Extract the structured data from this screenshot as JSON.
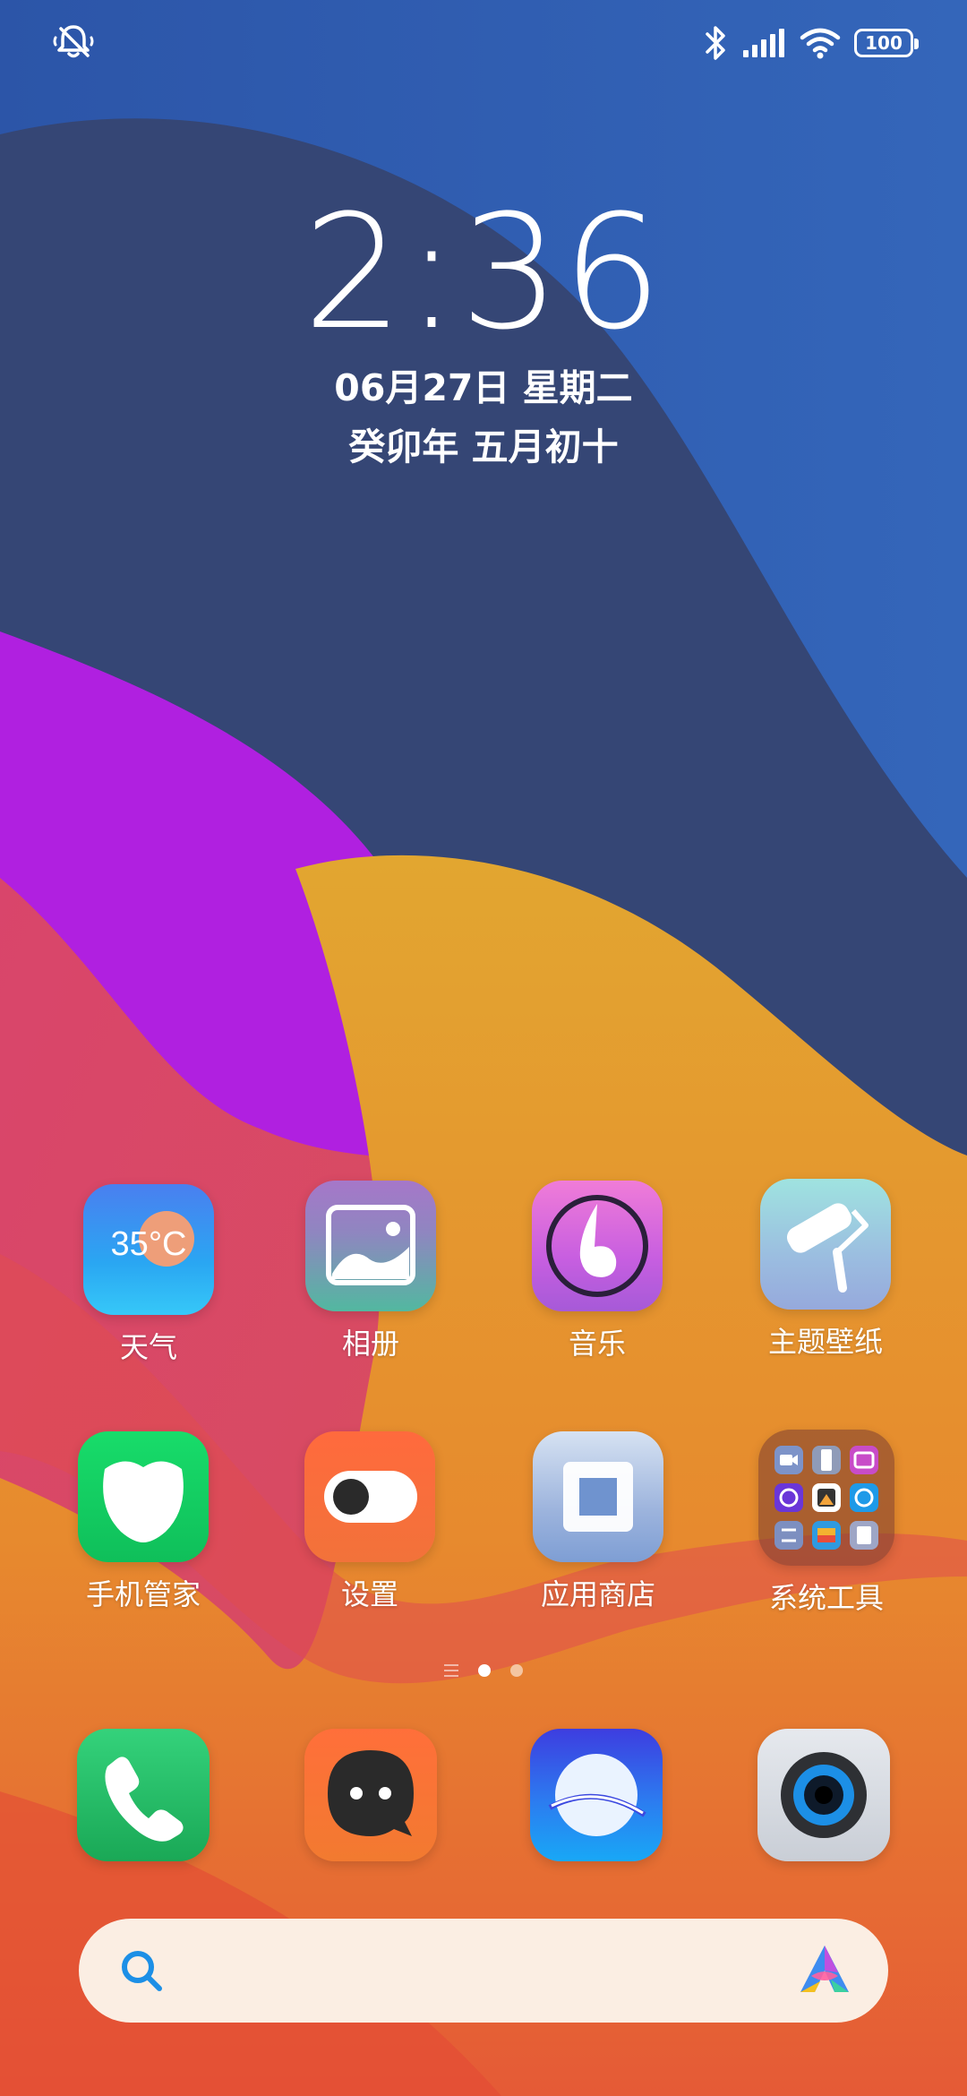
{
  "status_bar": {
    "left_icon": "mute-notification-icon",
    "right_icons": [
      "bluetooth-icon",
      "signal-icon",
      "wifi-icon"
    ],
    "battery": "100"
  },
  "clock": {
    "time": "2:36",
    "date": "06月27日 星期二",
    "lunar": "癸卯年 五月初十"
  },
  "apps": {
    "row1": [
      {
        "label": "天气",
        "icon": "weather-icon",
        "icon_text": "35°C"
      },
      {
        "label": "相册",
        "icon": "gallery-icon"
      },
      {
        "label": "音乐",
        "icon": "music-icon"
      },
      {
        "label": "主题壁纸",
        "icon": "theme-icon"
      }
    ],
    "row2": [
      {
        "label": "手机管家",
        "icon": "phone-manager-icon"
      },
      {
        "label": "设置",
        "icon": "settings-toggle-icon"
      },
      {
        "label": "应用商店",
        "icon": "app-store-icon"
      },
      {
        "label": "系统工具",
        "icon": "folder-icon"
      }
    ]
  },
  "page_indicator": {
    "pages": 3,
    "current": 2
  },
  "dock": [
    {
      "icon": "phone-icon"
    },
    {
      "icon": "messages-icon"
    },
    {
      "icon": "browser-icon"
    },
    {
      "icon": "camera-icon"
    }
  ],
  "search": {
    "placeholder": "",
    "left_icon": "search-icon",
    "right_icon": "assistant-icon"
  },
  "colors": {
    "wallpaper_blue": "#2f5fb6",
    "wallpaper_navy": "#354675",
    "wallpaper_purple": "#b020e0",
    "wallpaper_pink": "#d8486a",
    "wallpaper_yellow": "#e2a82e",
    "wallpaper_orange": "#e8762f"
  }
}
